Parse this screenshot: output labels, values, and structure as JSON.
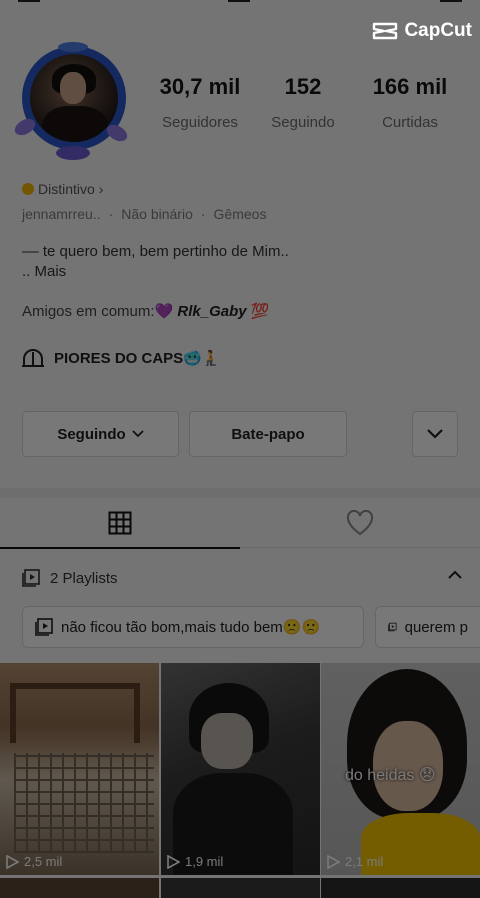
{
  "watermark": {
    "text": "CapCut"
  },
  "profile": {
    "stats": [
      {
        "value": "30,7 mil",
        "label": "Seguidores"
      },
      {
        "value": "152",
        "label": "Seguindo"
      },
      {
        "value": "166 mil",
        "label": "Curtidas"
      }
    ],
    "badge": "Distintivo",
    "meta": {
      "username": "jennamrreu..",
      "gender": "Não binário",
      "sign": "Gêmeos"
    },
    "bio_line1": "te quero bem, bem pertinho de Mim..",
    "bio_more": "Mais",
    "friends_label": "Amigos em comum:💜",
    "friends_name": "Rlk_Gaby",
    "friends_emoji": "💯",
    "group_name": "PIORES DO CAPS🥶🧎"
  },
  "actions": {
    "following_label": "Seguindo",
    "chat_label": "Bate-papo"
  },
  "playlists": {
    "header": "2 Playlists",
    "items": [
      "não ficou tão bom,mais tudo bem🙁🙁",
      "querem p"
    ]
  },
  "videos": [
    {
      "views": "2,5 mil",
      "caption": ""
    },
    {
      "views": "1,9 mil",
      "caption": ""
    },
    {
      "views": "2,1 mil",
      "caption": "do heidas 😞"
    }
  ],
  "colors": {
    "accent_ring": "#2b57c9",
    "badge": "#f4b400",
    "overlay": "rgba(0,0,0,0.52)"
  },
  "icons": [
    "capcut-logo-icon",
    "lock-dome-icon",
    "chevron-down-icon",
    "grid-icon",
    "heart-outline-icon",
    "playlist-icon",
    "chevron-up-icon",
    "play-icon"
  ]
}
